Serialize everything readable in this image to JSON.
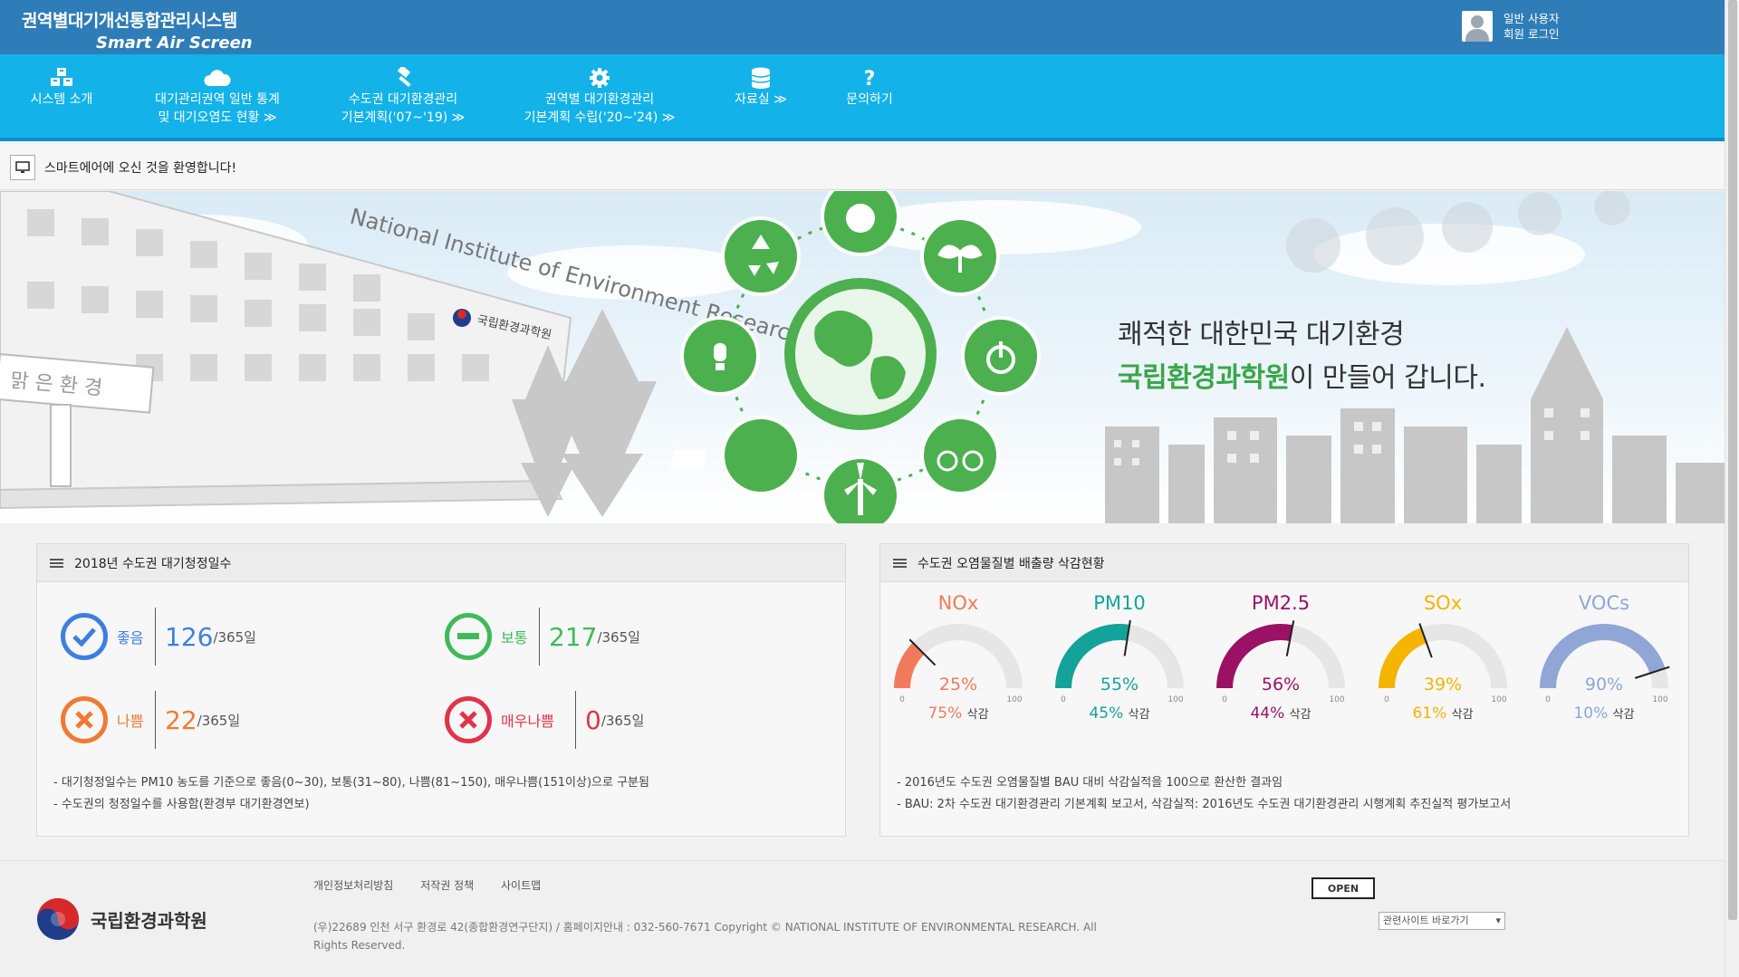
{
  "header": {
    "title_kr": "권역별대기개선통합관리시스템",
    "title_en": "Smart Air Screen",
    "user_type": "일반 사용자",
    "login_label": "회원 로그인"
  },
  "nav": [
    {
      "line1": "시스템 소개",
      "line2": "",
      "icon": "cubes-icon"
    },
    {
      "line1": "대기관리권역 일반 통계",
      "line2": "및 대기오염도 현황 ≫",
      "icon": "cloud-icon"
    },
    {
      "line1": "수도권 대기환경관리",
      "line2": "기본계획('07~'19) ≫",
      "icon": "gavel-icon"
    },
    {
      "line1": "권역별 대기환경관리",
      "line2": "기본계획 수립('20~'24) ≫",
      "icon": "gear-icon"
    },
    {
      "line1": "자료실 ≫",
      "line2": "",
      "icon": "database-icon"
    },
    {
      "line1": "문의하기",
      "line2": "",
      "icon": "question-icon"
    }
  ],
  "welcome": "스마트에어에 오신 것을 환영합니다!",
  "banner": {
    "building_en": "National Institute of Environment Research",
    "building_kr": "국립환경과학원",
    "sign": "맑 은 환 경",
    "slogan_line1": "쾌적한 대한민국 대기환경",
    "slogan_green": "국립환경과학원",
    "slogan_rest": "이 만들어 갑니다."
  },
  "left_panel": {
    "title": "2018년 수도권 대기청정일수",
    "stats": [
      {
        "label": "좋음",
        "value": "126",
        "denom": "/365일",
        "color": "#3d7fe0"
      },
      {
        "label": "보통",
        "value": "217",
        "denom": "/365일",
        "color": "#3fba5a"
      },
      {
        "label": "나쁨",
        "value": "22",
        "denom": "/365일",
        "color": "#f07a35"
      },
      {
        "label": "매우나쁨",
        "value": "0",
        "denom": "/365일",
        "color": "#e0344a"
      }
    ],
    "notes": [
      "- 대기청정일수는 PM10 농도를 기준으로 좋음(0~30), 보통(31~80), 나쁨(81~150), 매우나쁨(151이상)으로 구분됨",
      "- 수도권의 청정일수를 사용함(환경부 대기환경연보)"
    ]
  },
  "right_panel": {
    "title": "수도권 오염물질별 배출량 삭감현황",
    "min_label": "0",
    "max_label": "100",
    "reduction_suffix": "삭감",
    "gauges": [
      {
        "name": "NOx",
        "percent": 25,
        "percent_label": "25%",
        "reduction": "75%",
        "color": "#f07a5a"
      },
      {
        "name": "PM10",
        "percent": 55,
        "percent_label": "55%",
        "reduction": "45%",
        "color": "#14a39a"
      },
      {
        "name": "PM2.5",
        "percent": 56,
        "percent_label": "56%",
        "reduction": "44%",
        "color": "#9a1165"
      },
      {
        "name": "SOx",
        "percent": 39,
        "percent_label": "39%",
        "reduction": "61%",
        "color": "#f4b400"
      },
      {
        "name": "VOCs",
        "percent": 90,
        "percent_label": "90%",
        "reduction": "10%",
        "color": "#8fa6d6"
      }
    ],
    "notes": [
      "- 2016년도 수도권 오염물질별 BAU 대비 삭감실적을 100으로 환산한 결과임",
      "- BAU: 2차 수도권 대기환경관리 기본계획 보고서, 삭감실적: 2016년도 수도권 대기환경관리 시행계획 추진실적 평가보고서"
    ]
  },
  "footer": {
    "links": [
      "개인정보처리방침",
      "저작권 정책",
      "사이트맵"
    ],
    "org": "국립환경과학원",
    "address": "(우)22689 인천 서구 환경로 42(종합환경연구단지) / 홈페이지안내 : 032-560-7671 Copyright © NATIONAL INSTITUTE OF ENVIRONMENTAL RESEARCH. All Rights Reserved.",
    "open_badge": "OPEN",
    "related_select": "관련사이트 바로가기"
  }
}
